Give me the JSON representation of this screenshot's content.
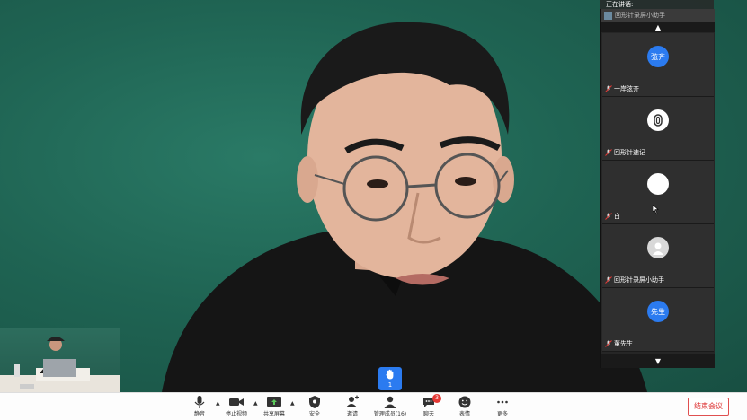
{
  "speaking_label": "正在讲话:",
  "top_tile": {
    "name": "回形针录屏小助手"
  },
  "participants": [
    {
      "name": "一岸弦齐",
      "avatar_text": "弦齐",
      "avatar_color": "#2b7bf0"
    },
    {
      "name": "回形针速记",
      "avatar_text": "",
      "avatar_color": "#ffffff"
    },
    {
      "name": "白",
      "avatar_text": "",
      "avatar_color": "#ffffff"
    },
    {
      "name": "回形针录屏小助手",
      "avatar_text": "",
      "avatar_color": "#d8d8d8"
    },
    {
      "name": "董先生",
      "avatar_text": "先生",
      "avatar_color": "#2b7bf0"
    }
  ],
  "raise_hand_count": "1",
  "toolbar": {
    "mute": "静音",
    "stop_video": "停止视频",
    "share_screen": "共享屏幕",
    "security": "安全",
    "invite": "邀请",
    "manage_participants": "管理成员(16)",
    "chat": "聊天",
    "chat_badge": "3",
    "reactions": "表情",
    "more": "更多",
    "end_meeting": "结束会议"
  }
}
